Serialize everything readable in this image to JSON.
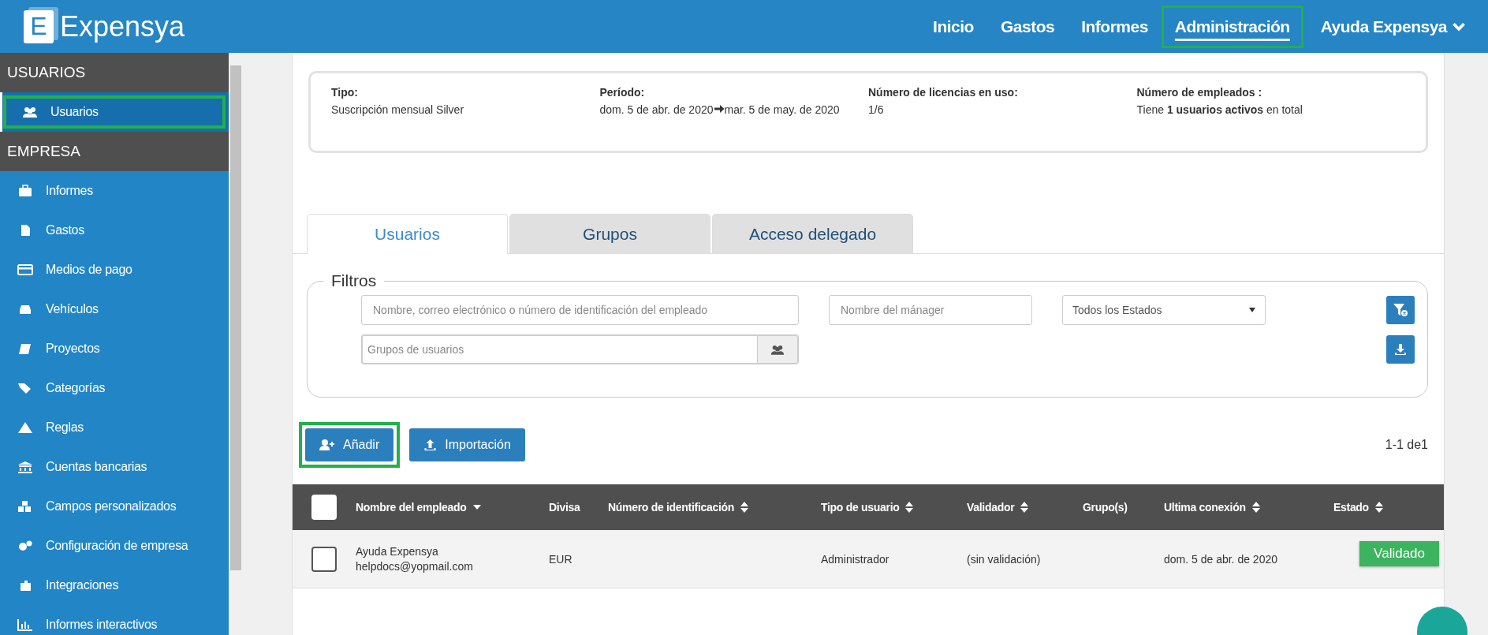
{
  "header": {
    "logo_letter": "E",
    "logo_text": "Expensya",
    "nav": [
      {
        "label": "Inicio",
        "selected": false,
        "highlighted": false
      },
      {
        "label": "Gastos",
        "selected": false,
        "highlighted": false
      },
      {
        "label": "Informes",
        "selected": false,
        "highlighted": false
      },
      {
        "label": "Administración",
        "selected": true,
        "highlighted": true
      }
    ],
    "user_menu": "Ayuda Expensya"
  },
  "sidebar": {
    "sections": [
      {
        "title": "USUARIOS",
        "items": [
          {
            "label": "Usuarios",
            "selected": true,
            "highlighted": true
          }
        ]
      },
      {
        "title": "EMPRESA",
        "items": [
          {
            "label": "Informes",
            "selected": false,
            "highlighted": false
          },
          {
            "label": "Gastos",
            "selected": false,
            "highlighted": false
          },
          {
            "label": "Medios de pago",
            "selected": false,
            "highlighted": false
          },
          {
            "label": "Vehículos",
            "selected": false,
            "highlighted": false
          },
          {
            "label": "Proyectos",
            "selected": false,
            "highlighted": false
          },
          {
            "label": "Categorías",
            "selected": false,
            "highlighted": false
          },
          {
            "label": "Reglas",
            "selected": false,
            "highlighted": false
          },
          {
            "label": "Cuentas bancarias",
            "selected": false,
            "highlighted": false
          },
          {
            "label": "Campos personalizados",
            "selected": false,
            "highlighted": false
          },
          {
            "label": "Configuración de empresa",
            "selected": false,
            "highlighted": false
          },
          {
            "label": "Integraciones",
            "selected": false,
            "highlighted": false
          },
          {
            "label": "Informes interactivos",
            "selected": false,
            "highlighted": false
          }
        ]
      }
    ]
  },
  "subscription": [
    {
      "label": "Tipo:",
      "value": "Suscripción mensual Silver"
    },
    {
      "label": "Período:",
      "value": "dom. 5 de abr. de 2020",
      "range_end": "mar. 5 de may. de 2020"
    },
    {
      "label": "Número de licencias en uso:",
      "value": "1/6"
    },
    {
      "label": "Número de empleados :",
      "value": "Tiene **1 usuarios activos** en total"
    }
  ],
  "tabs": [
    {
      "label": "Usuarios",
      "selected": true
    },
    {
      "label": "Grupos",
      "selected": false
    },
    {
      "label": "Acceso delegado",
      "selected": false
    }
  ],
  "filters": {
    "legend": "Filtros",
    "search_placeholder": "Nombre, correo electrónico o número de identificación del empleado",
    "manager_placeholder": "Nombre del mánager",
    "status_select": "Todos los Estados",
    "groups_placeholder": "Grupos de usuarios"
  },
  "actions": [
    {
      "label": "Añadir",
      "highlighted": true
    },
    {
      "label": "Importación",
      "highlighted": false
    }
  ],
  "pagination": "1-1 de1",
  "table": {
    "select_all_checked": false,
    "columns": [
      {
        "label": "Nombre del empleado",
        "sortable": true,
        "sorted": true
      },
      {
        "label": "Divisa",
        "sortable": false,
        "sorted": false
      },
      {
        "label": "Número de identificación",
        "sortable": true,
        "sorted": false
      },
      {
        "label": "Tipo de usuario",
        "sortable": true,
        "sorted": false
      },
      {
        "label": "Validador",
        "sortable": true,
        "sorted": false
      },
      {
        "label": "Grupo(s)",
        "sortable": false,
        "sorted": false
      },
      {
        "label": "Ultima conexión",
        "sortable": true,
        "sorted": false
      },
      {
        "label": "Estado",
        "sortable": true,
        "sorted": false
      }
    ],
    "rows": [
      {
        "checked": false,
        "name": "Ayuda Expensya",
        "email": "helpdocs@yopmail.com",
        "currency": "EUR",
        "user_type": "Administrador",
        "validator": "(sin validación)",
        "last_login": "dom. 5 de abr. de 2020",
        "status": "Validado"
      }
    ]
  }
}
